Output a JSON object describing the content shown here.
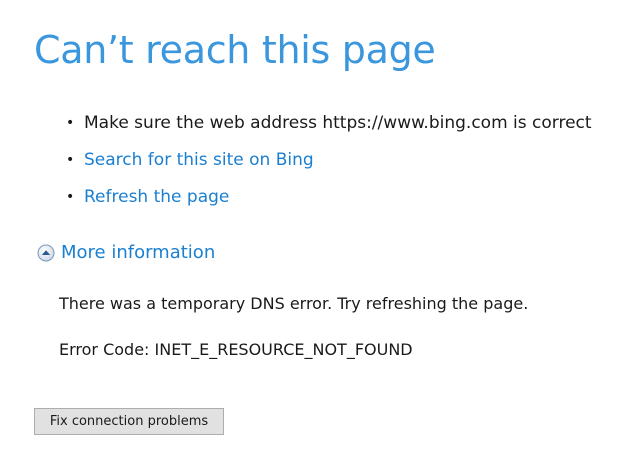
{
  "page": {
    "title": "Can’t reach this page"
  },
  "suggestions": [
    {
      "text": "Make sure the web address https://www.bing.com is correct"
    },
    {
      "text": "Search for this site on Bing"
    },
    {
      "text": "Refresh the page"
    }
  ],
  "bullet_glyph": "•",
  "more_info": {
    "label": "More information",
    "icon": "collapse-arrow-circle-icon"
  },
  "details": {
    "message": "There was a temporary DNS error. Try refreshing the page.",
    "error_code": "Error Code: INET_E_RESOURCE_NOT_FOUND"
  },
  "buttons": {
    "fix_connection": "Fix connection problems"
  },
  "colors": {
    "title": "#3a96dd",
    "link": "#1a7fd0",
    "button_bg": "#e1e1e1"
  }
}
